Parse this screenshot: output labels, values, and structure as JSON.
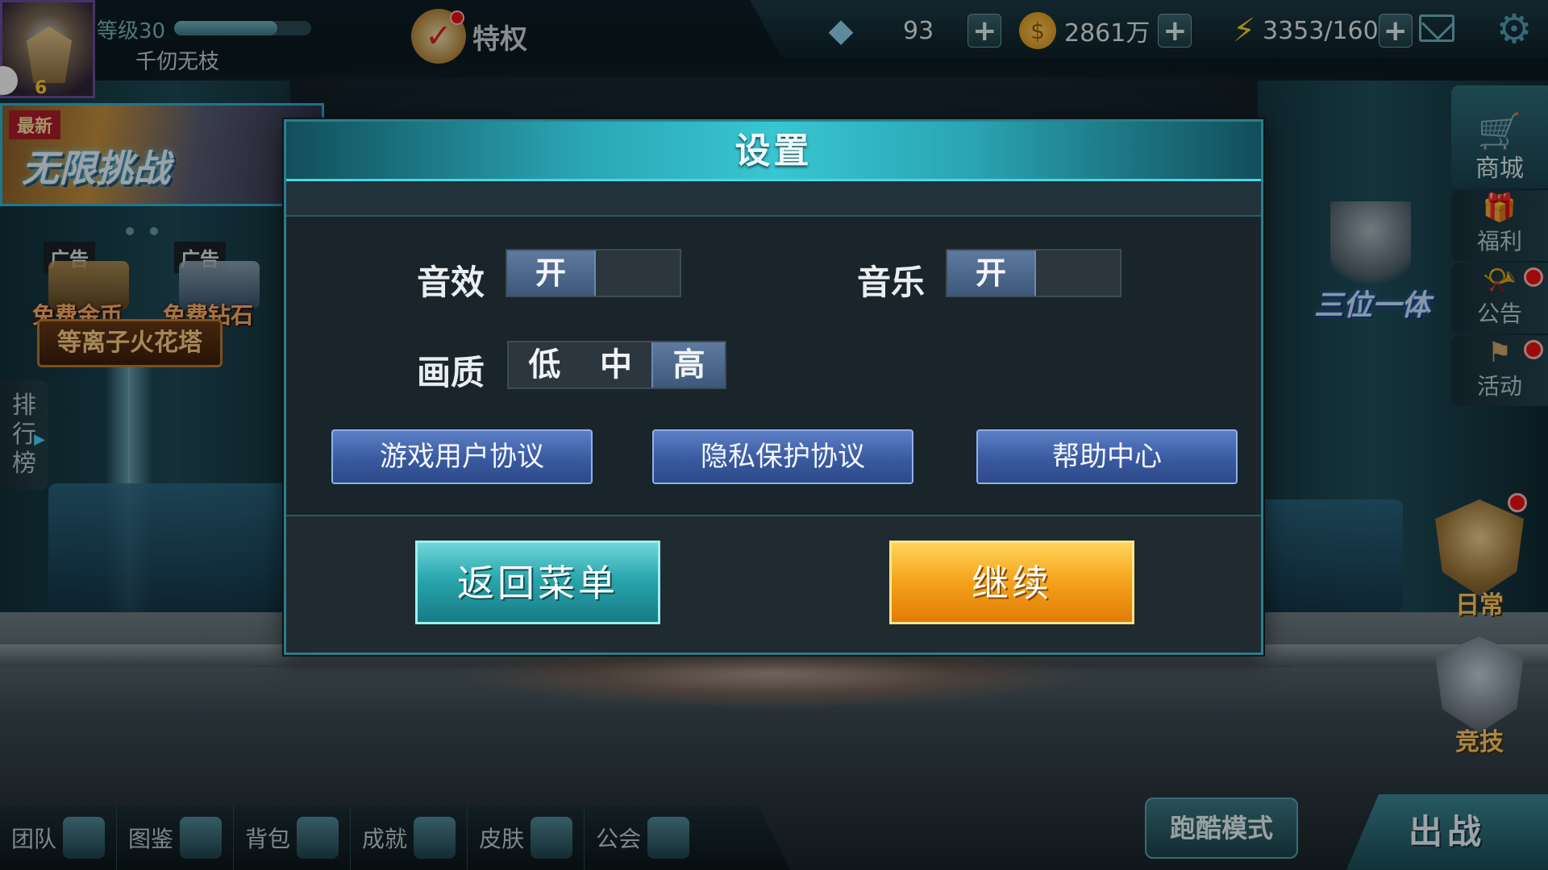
{
  "player": {
    "level_label": "等级30",
    "name": "千仞无枝",
    "avatar_level": "6",
    "xp_fraction": 0.75
  },
  "vip": {
    "label": "特权"
  },
  "currencies": {
    "diamonds": "93",
    "gold": "2861万",
    "stamina": "3353/160"
  },
  "left_panel": {
    "banner_tag": "最新",
    "banner_title": "无限挑战",
    "ad_tag": "广告",
    "ad_gold_label": "免费金币",
    "ad_diamond_label": "免费钻石",
    "tower_label": "等离子火花塔",
    "rank_tab": "排行榜"
  },
  "right_panel": {
    "shop": "商城",
    "welfare": "福利",
    "notice": "公告",
    "activity": "活动",
    "trinity": "三位一体",
    "daily": "日常",
    "arena": "竞技"
  },
  "bottom_nav": [
    {
      "label": "团队"
    },
    {
      "label": "图鉴"
    },
    {
      "label": "背包"
    },
    {
      "label": "成就"
    },
    {
      "label": "皮肤"
    },
    {
      "label": "公会"
    }
  ],
  "parkour_label": "跑酷模式",
  "battle_label": "出战",
  "settings": {
    "title": "设置",
    "sound_label": "音效",
    "sound_state": "开",
    "music_label": "音乐",
    "music_state": "开",
    "quality_label": "画质",
    "quality_options": [
      "低",
      "中",
      "高"
    ],
    "quality_selected": "高",
    "user_agreement": "游戏用户协议",
    "privacy_agreement": "隐私保护协议",
    "help_center": "帮助中心",
    "return_menu": "返回菜单",
    "continue": "继续"
  },
  "colors": {
    "dialog_header": "#2aa5b4",
    "link_button": "#3a5aa0",
    "return_button": "#2aa6ae",
    "continue_button": "#f5a11a"
  }
}
